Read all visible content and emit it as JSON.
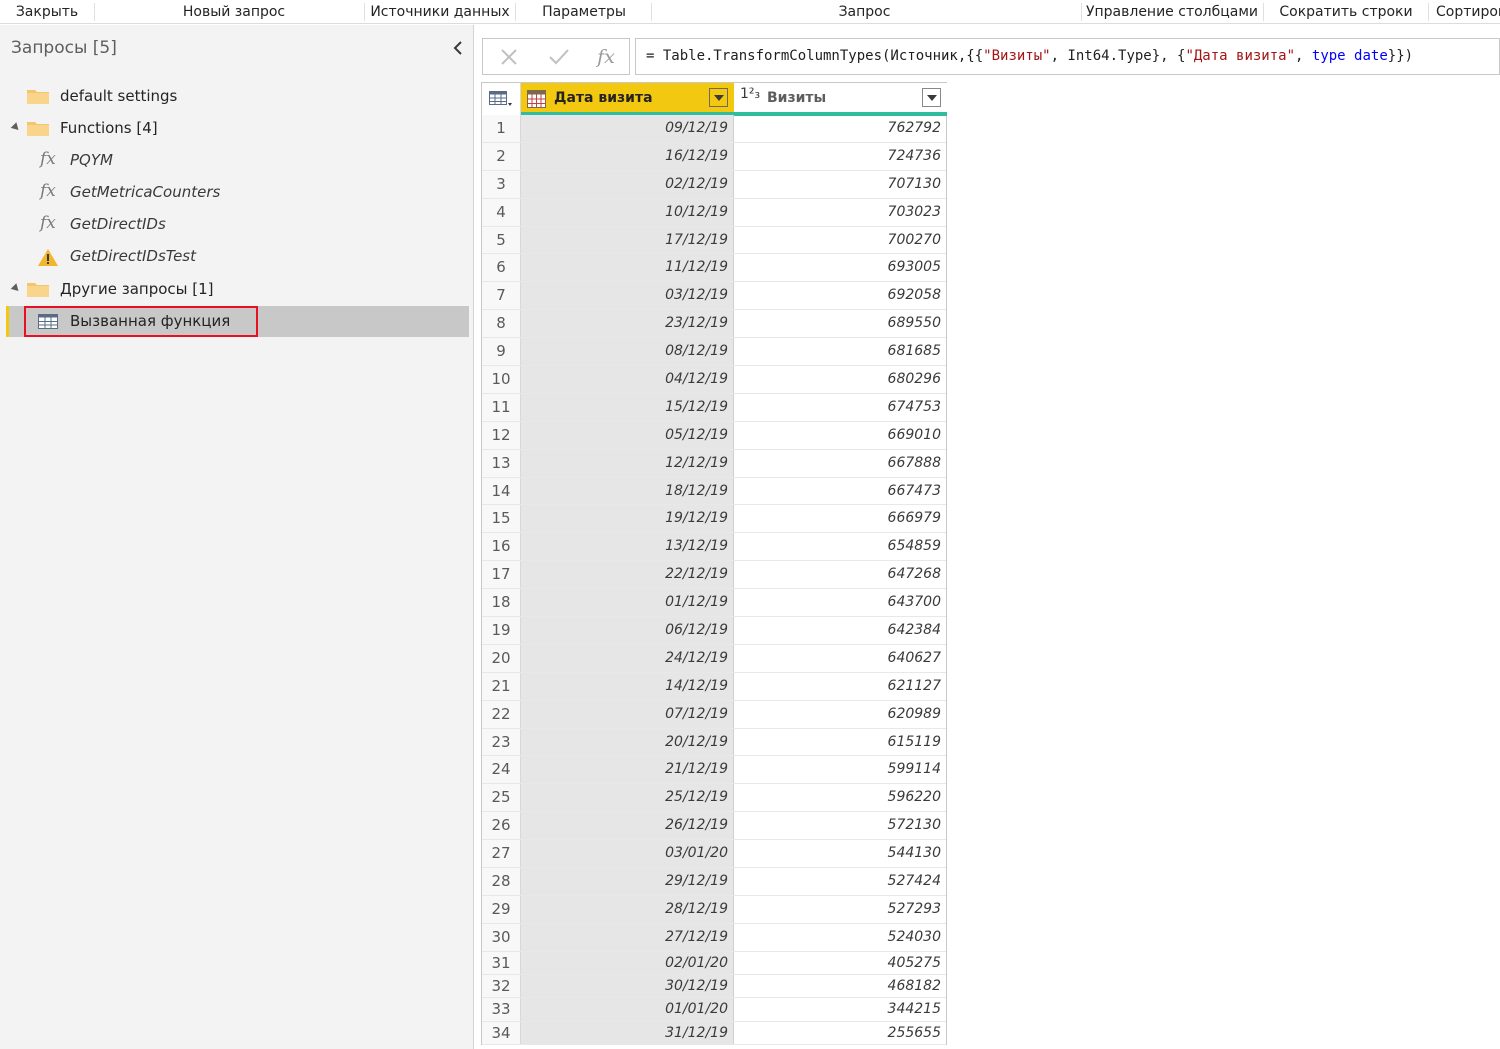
{
  "ribbon": {
    "groups": [
      "Закрыть",
      "Новый запрос",
      "Источники данных",
      "Параметры",
      "Запрос",
      "Управление столбцами",
      "Сократить строки",
      "Сортиров"
    ]
  },
  "queries_pane": {
    "title": "Запросы [5]",
    "collapse_icon": "chevron-left-icon",
    "items": [
      {
        "label": "default settings",
        "type": "folder"
      },
      {
        "label": "Functions [4]",
        "type": "folder-group"
      },
      {
        "label": "PQYM",
        "type": "function"
      },
      {
        "label": "GetMetricaCounters",
        "type": "function"
      },
      {
        "label": "GetDirectIDs",
        "type": "function"
      },
      {
        "label": "GetDirectIDsTest",
        "type": "function-warning"
      },
      {
        "label": "Другие запросы [1]",
        "type": "folder-group"
      },
      {
        "label": "Вызванная функция",
        "type": "table",
        "selected": true
      }
    ],
    "highlight_color": "#e81123",
    "accent_color": "#f2c811"
  },
  "formula_bar": {
    "cancel_icon": "close-icon",
    "commit_icon": "check-icon",
    "fx_label": "fx",
    "parts": [
      {
        "t": "= Table.TransformColumnTypes(Источник,{{",
        "c": "plain"
      },
      {
        "t": "\"Визиты\"",
        "c": "str"
      },
      {
        "t": ", Int64.Type}, {",
        "c": "plain"
      },
      {
        "t": "\"Дата визита\"",
        "c": "str"
      },
      {
        "t": ", ",
        "c": "plain"
      },
      {
        "t": "type",
        "c": "kw"
      },
      {
        "t": " ",
        "c": "plain"
      },
      {
        "t": "date",
        "c": "kw"
      },
      {
        "t": "}})",
        "c": "plain"
      }
    ]
  },
  "grid": {
    "columns": [
      {
        "name": "Дата визита",
        "type_icon": "calendar-table-icon"
      },
      {
        "name": "Визиты",
        "type_icon": "whole-number-type-icon",
        "type_label": "1²₃"
      }
    ],
    "header_accent": "#f2c811",
    "quality_color": "#2fbd9d",
    "rows": [
      [
        "09/12/19",
        "762792"
      ],
      [
        "16/12/19",
        "724736"
      ],
      [
        "02/12/19",
        "707130"
      ],
      [
        "10/12/19",
        "703023"
      ],
      [
        "17/12/19",
        "700270"
      ],
      [
        "11/12/19",
        "693005"
      ],
      [
        "03/12/19",
        "692058"
      ],
      [
        "23/12/19",
        "689550"
      ],
      [
        "08/12/19",
        "681685"
      ],
      [
        "04/12/19",
        "680296"
      ],
      [
        "15/12/19",
        "674753"
      ],
      [
        "05/12/19",
        "669010"
      ],
      [
        "12/12/19",
        "667888"
      ],
      [
        "18/12/19",
        "667473"
      ],
      [
        "19/12/19",
        "666979"
      ],
      [
        "13/12/19",
        "654859"
      ],
      [
        "22/12/19",
        "647268"
      ],
      [
        "01/12/19",
        "643700"
      ],
      [
        "06/12/19",
        "642384"
      ],
      [
        "24/12/19",
        "640627"
      ],
      [
        "14/12/19",
        "621127"
      ],
      [
        "07/12/19",
        "620989"
      ],
      [
        "20/12/19",
        "615119"
      ],
      [
        "21/12/19",
        "599114"
      ],
      [
        "25/12/19",
        "596220"
      ],
      [
        "26/12/19",
        "572130"
      ],
      [
        "03/01/20",
        "544130"
      ],
      [
        "29/12/19",
        "527424"
      ],
      [
        "28/12/19",
        "527293"
      ],
      [
        "27/12/19",
        "524030"
      ],
      [
        "02/01/20",
        "405275"
      ],
      [
        "30/12/19",
        "468182"
      ],
      [
        "01/01/20",
        "344215"
      ],
      [
        "31/12/19",
        "255655"
      ]
    ]
  }
}
